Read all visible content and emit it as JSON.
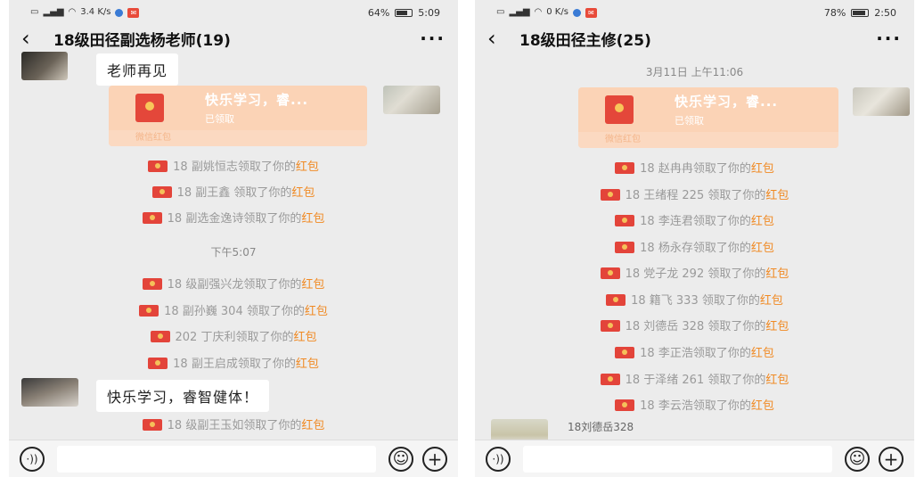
{
  "left": {
    "status": {
      "network": "3.4 K/s",
      "battery_text": "64%",
      "battery_level": 0.64,
      "time": "5:09"
    },
    "title": "18级田径副选杨老师(19)",
    "bubble_1": "老师再见",
    "red_packet": {
      "title": "快乐学习，睿...",
      "status": "已领取",
      "footer": "微信红包"
    },
    "notices_1": [
      {
        "text": "18 副姚恒志领取了你的",
        "highlight": "红包"
      },
      {
        "text": "18 副王鑫 领取了你的",
        "highlight": "红包"
      },
      {
        "text": "18 副选金逸诗领取了你的",
        "highlight": "红包"
      }
    ],
    "timestamp": "下午5:07",
    "notices_2": [
      {
        "text": "18 级副强兴龙领取了你的",
        "highlight": "红包"
      },
      {
        "text": "18 副孙巍 304 领取了你的",
        "highlight": "红包"
      },
      {
        "text": "202 丁庆利领取了你的",
        "highlight": "红包"
      },
      {
        "text": "18 副王启成领取了你的",
        "highlight": "红包"
      }
    ],
    "bubble_2": "快乐学习，睿智健体！",
    "notices_3": [
      {
        "text": "18 级副王玉如领取了你的",
        "highlight": "红包"
      }
    ]
  },
  "right": {
    "status": {
      "network": "0 K/s",
      "battery_text": "78%",
      "battery_level": 0.78,
      "time": "2:50"
    },
    "title": "18级田径主修(25)",
    "timestamp": "3月11日 上午11:06",
    "red_packet": {
      "title": "快乐学习，睿...",
      "status": "已领取",
      "footer": "微信红包"
    },
    "notices": [
      {
        "text": "18 赵冉冉领取了你的",
        "highlight": "红包"
      },
      {
        "text": "18 王绪程  225 领取了你的",
        "highlight": "红包"
      },
      {
        "text": "18 李连君领取了你的",
        "highlight": "红包"
      },
      {
        "text": "18 杨永存领取了你的",
        "highlight": "红包"
      },
      {
        "text": "18 党子龙 292 领取了你的",
        "highlight": "红包"
      },
      {
        "text": "18 籍飞  333 领取了你的",
        "highlight": "红包"
      },
      {
        "text": "18 刘德岳 328 领取了你的",
        "highlight": "红包"
      },
      {
        "text": "18 李正浩领取了你的",
        "highlight": "红包"
      },
      {
        "text": "18 于泽绪 261 领取了你的",
        "highlight": "红包"
      },
      {
        "text": "18 李云浩领取了你的",
        "highlight": "红包"
      }
    ],
    "last_sender": "18刘德岳328"
  },
  "colors": {
    "accent_orange": "#f08a24",
    "packet_red": "#e4473a",
    "packet_bg": "#fbd3b6",
    "chat_bg": "#ececec"
  },
  "icons": {
    "back": "chevron-left-icon",
    "more": "more-icon",
    "voice": "voice-icon",
    "emoji": "emoji-icon",
    "plus": "plus-icon"
  }
}
